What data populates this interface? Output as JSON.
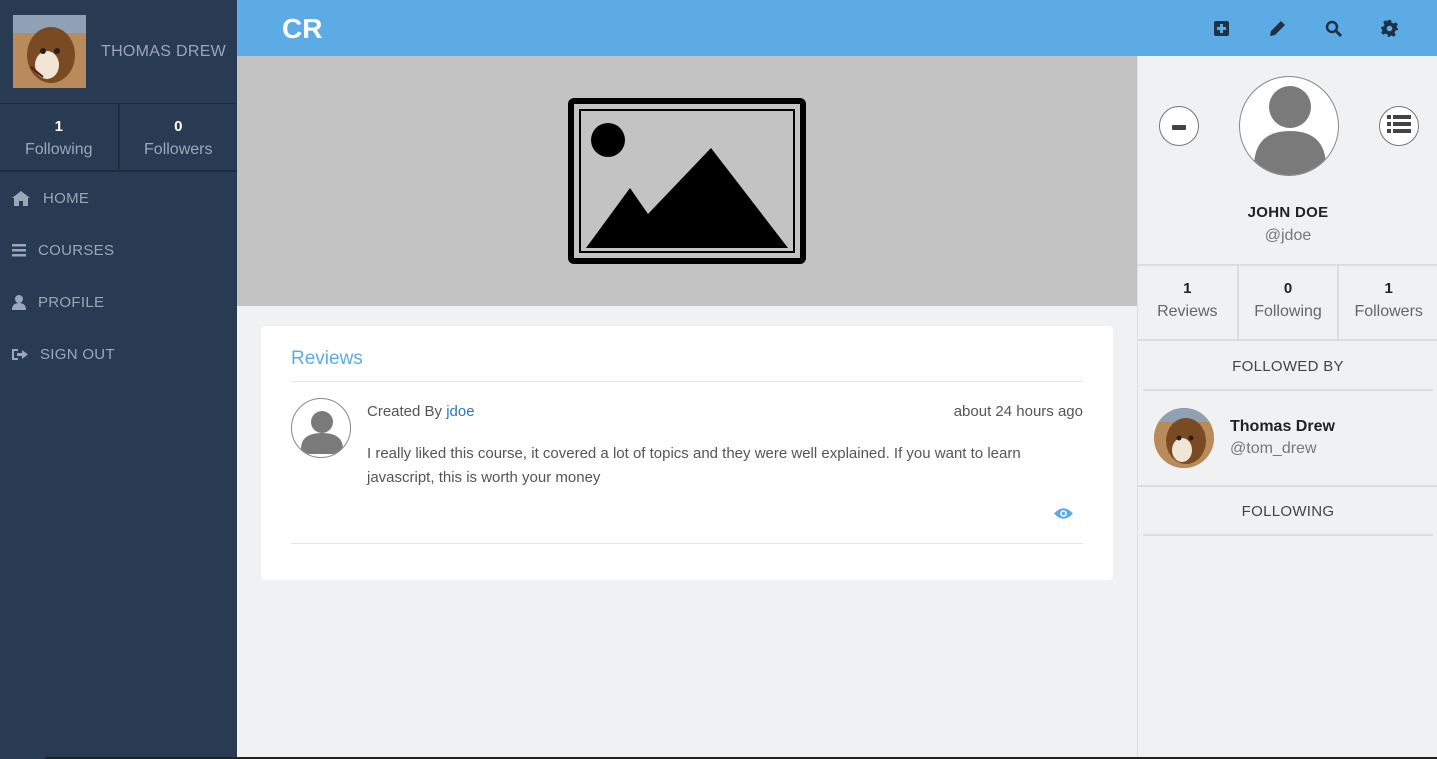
{
  "sidebar": {
    "user_name": "THOMAS DREW",
    "stats": [
      {
        "value": "1",
        "label": "Following"
      },
      {
        "value": "0",
        "label": "Followers"
      }
    ],
    "nav": [
      {
        "label": "HOME",
        "icon": "home-icon"
      },
      {
        "label": "COURSES",
        "icon": "bars-icon"
      },
      {
        "label": "PROFILE",
        "icon": "user-icon"
      },
      {
        "label": "SIGN OUT",
        "icon": "sign-out-icon"
      }
    ]
  },
  "topbar": {
    "brand": "CR",
    "icons": [
      "plus-square-icon",
      "pencil-icon",
      "search-icon",
      "gear-icon"
    ]
  },
  "main": {
    "reviews_title": "Reviews",
    "review": {
      "created_by_label": "Created By",
      "author": "jdoe",
      "time": "about 24 hours ago",
      "text": "I really liked this course, it covered a lot of topics and they were well explained. If you want to learn javascript, this is worth your money"
    }
  },
  "profile": {
    "name": "JOHN DOE",
    "handle": "@jdoe",
    "stats": [
      {
        "value": "1",
        "label": "Reviews"
      },
      {
        "value": "0",
        "label": "Following"
      },
      {
        "value": "1",
        "label": "Followers"
      }
    ],
    "followed_by_title": "FOLLOWED BY",
    "followers": [
      {
        "name": "Thomas Drew",
        "handle": "@tom_drew"
      }
    ],
    "following_title": "FOLLOWING"
  },
  "colors": {
    "sidebar_bg": "#283b53",
    "topbar_bg": "#5dabe4",
    "accent": "#5dabe4",
    "link": "#2b79c2"
  }
}
